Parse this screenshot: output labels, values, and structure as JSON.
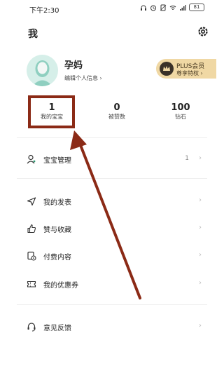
{
  "status_bar": {
    "time": "下午2:30",
    "battery": "81"
  },
  "header": {
    "title": "我"
  },
  "profile": {
    "name": "孕妈",
    "edit_link": "编辑个人信息 ›",
    "plus_title": "PLUS会员",
    "plus_subtitle": "尊享特权 ›"
  },
  "stats": [
    {
      "value": "1",
      "label": "我的宝宝"
    },
    {
      "value": "0",
      "label": "被赞数"
    },
    {
      "value": "100",
      "label": "钻石"
    }
  ],
  "menu": {
    "baby_manage": {
      "label": "宝宝管理",
      "count": "1"
    },
    "my_posts": {
      "label": "我的发表"
    },
    "likes_favorites": {
      "label": "赞与收藏"
    },
    "paid_content": {
      "label": "付费内容"
    },
    "coupons": {
      "label": "我的优惠券"
    },
    "feedback": {
      "label": "意见反馈"
    }
  },
  "chevron": "›",
  "colors": {
    "annotation": "#8b2a16",
    "plus_gold": "#f0d8a4",
    "avatar_bg": "#d6efe9"
  }
}
